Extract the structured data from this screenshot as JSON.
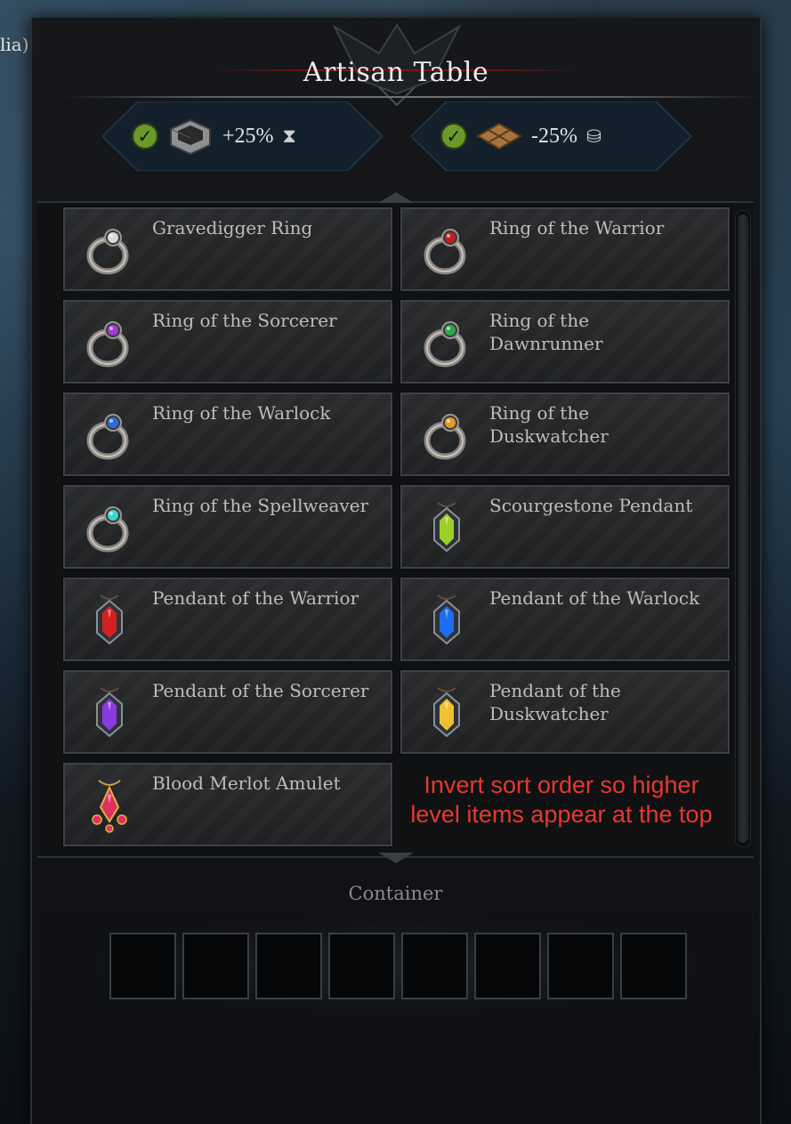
{
  "background": {
    "left_text": "lia)"
  },
  "window": {
    "title": "Artisan Table"
  },
  "bonuses": [
    {
      "value": "+25%",
      "icon": "hourglass-icon",
      "station": "stone-frame-icon",
      "active": true
    },
    {
      "value": "-25%",
      "icon": "coins-icon",
      "station": "wood-planks-icon",
      "active": true
    }
  ],
  "recipes": [
    {
      "name": "Gravedigger Ring",
      "gem": "#d9d9d9",
      "type": "ring"
    },
    {
      "name": "Ring of the Warrior",
      "gem": "#c02020",
      "type": "ring"
    },
    {
      "name": "Ring of the Sorcerer",
      "gem": "#a23ad6",
      "type": "ring"
    },
    {
      "name": "Ring of the Dawnrunner",
      "gem": "#2fa84a",
      "type": "ring"
    },
    {
      "name": "Ring of the Warlock",
      "gem": "#2a6de0",
      "type": "ring"
    },
    {
      "name": "Ring of the Duskwatcher",
      "gem": "#e09a20",
      "type": "ring"
    },
    {
      "name": "Ring of the Spellweaver",
      "gem": "#3fd6d0",
      "type": "ring"
    },
    {
      "name": "Scourgestone Pendant",
      "gem": "#9ccf28",
      "type": "pendant"
    },
    {
      "name": "Pendant of the Warrior",
      "gem": "#d42020",
      "type": "pendant"
    },
    {
      "name": "Pendant of the Warlock",
      "gem": "#1e6df0",
      "type": "pendant"
    },
    {
      "name": "Pendant of the Sorcerer",
      "gem": "#8a3ae0",
      "type": "pendant"
    },
    {
      "name": "Pendant of the Duskwatcher",
      "gem": "#f0c030",
      "type": "pendant"
    },
    {
      "name": "Blood Merlot Amulet",
      "gem": "#e03060",
      "type": "amulet"
    }
  ],
  "note": "Invert sort order so higher level items appear at the top",
  "container": {
    "label": "Container",
    "slot_count": 8
  }
}
